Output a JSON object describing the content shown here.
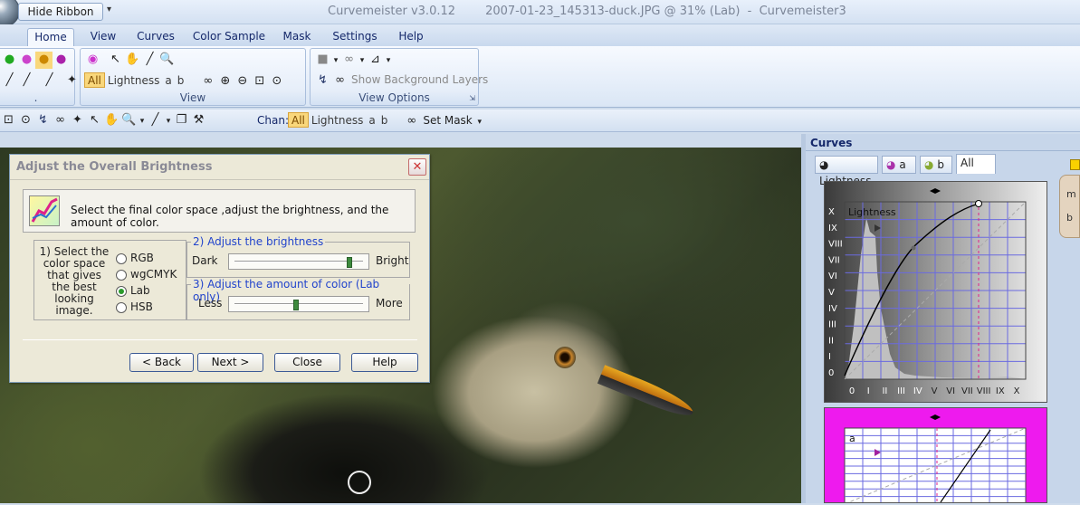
{
  "window": {
    "hide_ribbon": "Hide Ribbon",
    "app_name": "Curvemeister v3.0.12",
    "document": "2007-01-23_145313-duck.JPG @ 31% (Lab)  -  Curvemeister3"
  },
  "tabs": [
    "Home",
    "View",
    "Curves",
    "Color Sample",
    "Mask",
    "Settings",
    "Help"
  ],
  "ribbon": {
    "view_group": {
      "label": "View",
      "channels": [
        "All",
        "Lightness",
        "a",
        "b"
      ]
    },
    "view_options_group": {
      "label": "View Options",
      "show_background_layers": "Show Background Layers"
    },
    "left_group_label": "."
  },
  "toolbar": {
    "chan_label": "Chan:",
    "channels": [
      "All",
      "Lightness",
      "a",
      "b"
    ],
    "set_mask": "Set Mask"
  },
  "dialog": {
    "title": "Adjust the Overall Brightness",
    "banner": "Select the final color space ,adjust the brightness, and the amount of color.",
    "colorspace_text": "1) Select the color space that gives the best looking image.",
    "colorspaces": [
      {
        "label": "RGB",
        "selected": false
      },
      {
        "label": "wgCMYK",
        "selected": false
      },
      {
        "label": "Lab",
        "selected": true
      },
      {
        "label": "HSB",
        "selected": false
      }
    ],
    "brightness": {
      "legend": "2) Adjust the brightness",
      "left": "Dark",
      "right": "Bright",
      "value": 0.92
    },
    "color_amount": {
      "legend": "3) Adjust the amount of color (Lab only)",
      "left": "Less",
      "right": "More",
      "value": 0.5
    },
    "buttons": {
      "back": "< Back",
      "next": "Next >",
      "close": "Close",
      "help": "Help"
    }
  },
  "curves": {
    "title": "Curves",
    "tabs": [
      "Lightness",
      "a",
      "b",
      "All"
    ],
    "active_tab": "All",
    "graph1": {
      "label": "Lightness",
      "y_ticks": [
        "X",
        "IX",
        "VIII",
        "VII",
        "VI",
        "V",
        "IV",
        "III",
        "II",
        "I",
        "0"
      ],
      "x_ticks": [
        "0",
        "I",
        "II",
        "III",
        "IV",
        "V",
        "VI",
        "VII",
        "VIII",
        "IX",
        "X"
      ]
    },
    "graph2": {
      "label": "a"
    },
    "side_nav": [
      "m",
      "b"
    ]
  },
  "colors": {
    "dialog_bg": "#ece9d8",
    "slider_thumb": "#3d8a3d",
    "accent_all": "#f9d77b",
    "curve_magenta": "#ee1aee"
  }
}
